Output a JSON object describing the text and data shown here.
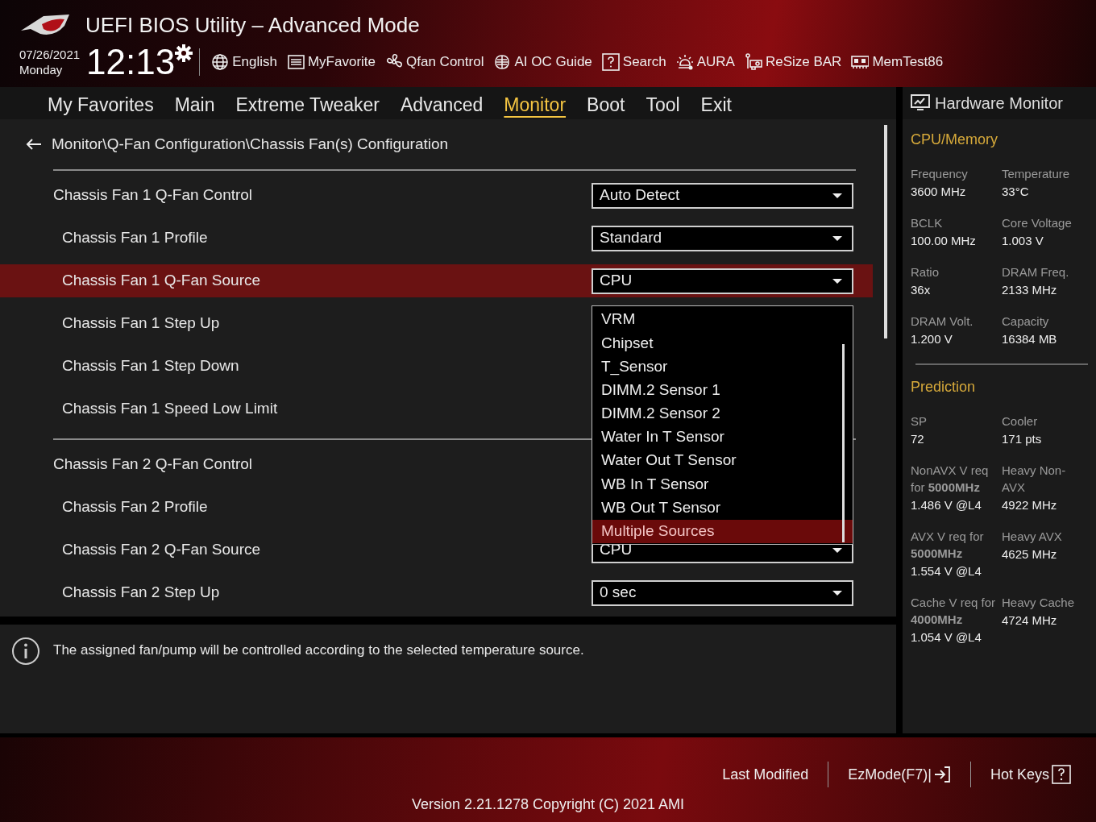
{
  "header": {
    "title": "UEFI BIOS Utility – Advanced Mode",
    "date": "07/26/2021",
    "day": "Monday",
    "time": "12:13"
  },
  "toolbar": [
    {
      "label": "English",
      "kind": "globe"
    },
    {
      "label": "MyFavorite",
      "kind": "list"
    },
    {
      "label": "Qfan Control",
      "kind": "fan"
    },
    {
      "label": "AI OC Guide",
      "kind": "chip"
    },
    {
      "label": "Search",
      "kind": "help"
    },
    {
      "label": "AURA",
      "kind": "light"
    },
    {
      "label": "ReSize BAR",
      "kind": "card"
    },
    {
      "label": "MemTest86",
      "kind": "memory"
    }
  ],
  "tabs": [
    {
      "label": "My Favorites",
      "selected": false
    },
    {
      "label": "Main",
      "selected": false
    },
    {
      "label": "Extreme Tweaker",
      "selected": false
    },
    {
      "label": "Advanced",
      "selected": false
    },
    {
      "label": "Monitor",
      "selected": true
    },
    {
      "label": "Boot",
      "selected": false
    },
    {
      "label": "Tool",
      "selected": false
    },
    {
      "label": "Exit",
      "selected": false
    }
  ],
  "breadcrumb": "Monitor\\Q-Fan Configuration\\Chassis Fan(s) Configuration",
  "groups": [
    {
      "label": "Chassis Fan 1 Q-Fan Control",
      "value": "Auto Detect",
      "selected": false,
      "children": [
        {
          "label": "Chassis Fan 1 Profile",
          "value": "Standard",
          "selected": false
        },
        {
          "label": "Chassis Fan 1 Q-Fan Source",
          "value": "CPU",
          "selected": true
        },
        {
          "label": "Chassis Fan 1 Step Up",
          "selected": false
        },
        {
          "label": "Chassis Fan 1 Step Down",
          "selected": false
        },
        {
          "label": "Chassis Fan 1 Speed Low Limit",
          "selected": false
        }
      ]
    },
    {
      "label": "Chassis Fan 2 Q-Fan Control",
      "selected": false,
      "children": [
        {
          "label": "Chassis Fan 2 Profile",
          "selected": false
        },
        {
          "label": "Chassis Fan 2 Q-Fan Source",
          "value": "CPU",
          "selected": false
        },
        {
          "label": "Chassis Fan 2 Step Up",
          "value": "0 sec",
          "selected": false
        }
      ]
    }
  ],
  "dropdown": {
    "options": [
      {
        "label": "VRM",
        "selected": false
      },
      {
        "label": "Chipset",
        "selected": false
      },
      {
        "label": "T_Sensor",
        "selected": false
      },
      {
        "label": "DIMM.2 Sensor 1",
        "selected": false
      },
      {
        "label": "DIMM.2 Sensor 2",
        "selected": false
      },
      {
        "label": "Water In T Sensor",
        "selected": false
      },
      {
        "label": "Water Out T Sensor",
        "selected": false
      },
      {
        "label": "WB In T Sensor",
        "selected": false
      },
      {
        "label": "WB Out T Sensor",
        "selected": false
      },
      {
        "label": "Multiple Sources",
        "selected": true
      }
    ]
  },
  "help": "The assigned fan/pump will be controlled according to the selected temperature source.",
  "monitor": {
    "title": "Hardware Monitor",
    "sections": [
      {
        "title": "CPU/Memory",
        "items": [
          {
            "label": "Frequency",
            "value": "3600 MHz"
          },
          {
            "label": "Temperature",
            "value": "33°C"
          },
          {
            "label": "BCLK",
            "value": "100.00 MHz"
          },
          {
            "label": "Core Voltage",
            "value": "1.003 V"
          },
          {
            "label": "Ratio",
            "value": "36x"
          },
          {
            "label": "DRAM Freq.",
            "value": "2133 MHz"
          },
          {
            "label": "DRAM Volt.",
            "value": "1.200 V"
          },
          {
            "label": "Capacity",
            "value": "16384 MB"
          }
        ]
      },
      {
        "title": "Prediction",
        "items": [
          {
            "label": "SP",
            "value": "72"
          },
          {
            "label": "Cooler",
            "value": "171 pts"
          },
          {
            "label": "NonAVX V req for **5000MHz**",
            "value": "1.486 V @L4"
          },
          {
            "label": "Heavy Non-AVX",
            "value": "4922 MHz"
          },
          {
            "label": "AVX V req for **5000MHz**",
            "value": "1.554 V @L4"
          },
          {
            "label": "Heavy AVX",
            "value": "4625 MHz"
          },
          {
            "label": "Cache V req for **4000MHz**",
            "value": "1.054 V @L4"
          },
          {
            "label": "Heavy Cache",
            "value": "4724 MHz"
          }
        ]
      }
    ]
  },
  "footer": {
    "buttons": [
      {
        "label": "Last Modified",
        "kind": "plain"
      },
      {
        "label": "EzMode(F7)|",
        "kind": "exit"
      },
      {
        "label": "Hot Keys",
        "kind": "help"
      }
    ],
    "version": "Version 2.21.1278 Copyright (C) 2021 AMI"
  }
}
